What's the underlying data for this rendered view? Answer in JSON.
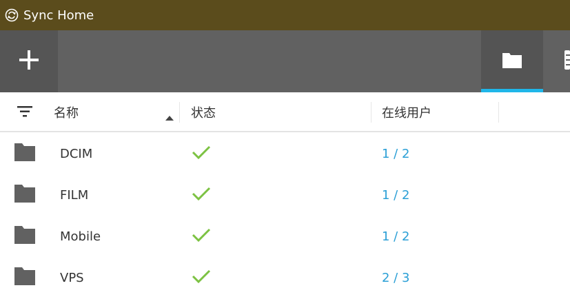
{
  "window": {
    "title": "Sync Home",
    "icon": "sync-icon"
  },
  "toolbar": {
    "add_icon": "plus-icon",
    "tabs": [
      {
        "icon": "folder-icon",
        "active": true
      },
      {
        "icon": "list-icon",
        "active": false
      }
    ],
    "accent": "#1fb6e9"
  },
  "table": {
    "headers": {
      "name": "名称",
      "status": "状态",
      "online": "在线用户"
    },
    "sort": {
      "column": "name",
      "direction": "ascending"
    },
    "rows": [
      {
        "name": "DCIM",
        "status": "ok",
        "online": "1 / 2"
      },
      {
        "name": "FILM",
        "status": "ok",
        "online": "1 / 2"
      },
      {
        "name": "Mobile",
        "status": "ok",
        "online": "1 / 2"
      },
      {
        "name": "VPS",
        "status": "ok",
        "online": "2 / 3"
      }
    ]
  },
  "colors": {
    "titlebar": "#5b4c1c",
    "toolbar": "#616161",
    "status_ok": "#7cc242",
    "link": "#2a9fd6"
  }
}
